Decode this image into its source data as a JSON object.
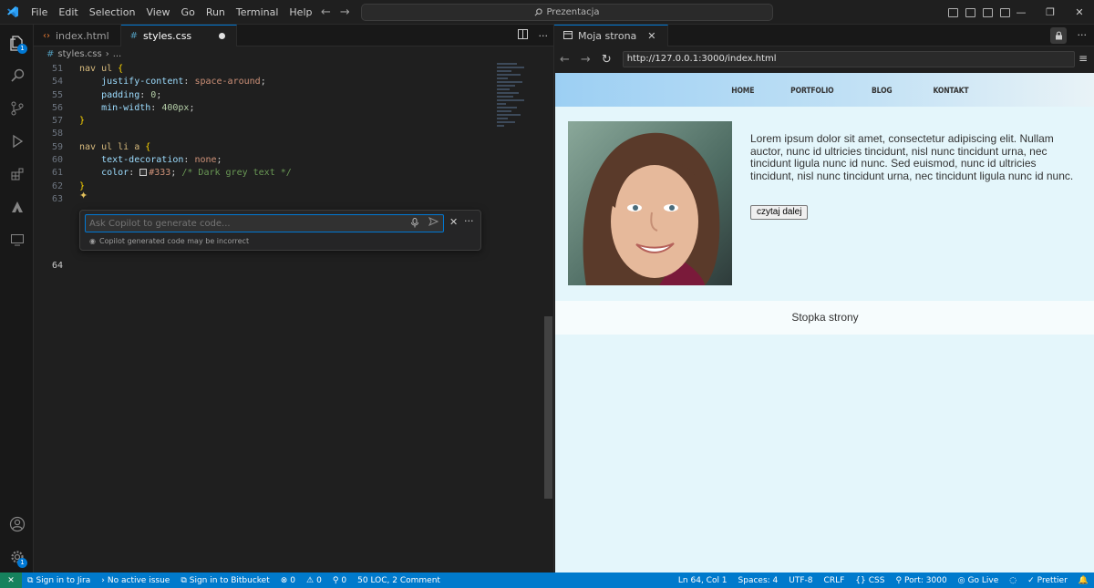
{
  "titlebar": {
    "menu": [
      "File",
      "Edit",
      "Selection",
      "View",
      "Go",
      "Run",
      "Terminal",
      "Help"
    ],
    "search_text": "Prezentacja"
  },
  "activity_bar": {
    "explorer_badge": "1",
    "settings_badge": "1"
  },
  "editor": {
    "tabs": [
      {
        "label": "index.html",
        "icon": "html-icon"
      },
      {
        "label": "styles.css",
        "icon": "css-icon",
        "modified": true
      }
    ],
    "breadcrumb": {
      "file": "styles.css",
      "rest": "..."
    },
    "lines": [
      {
        "n": "51",
        "parts": [
          [
            "sel",
            "nav ul "
          ],
          [
            "br",
            "{"
          ]
        ]
      },
      {
        "n": "54",
        "parts": [
          [
            "prop",
            "    justify-content"
          ],
          [
            "",
            "; "
          ],
          [
            "val",
            "space-around"
          ],
          [
            "",
            ";"
          ]
        ]
      },
      {
        "n": "55",
        "parts": [
          [
            "prop",
            "    padding"
          ],
          [
            "",
            ": "
          ],
          [
            "num",
            "0"
          ],
          [
            "",
            ";"
          ]
        ]
      },
      {
        "n": "56",
        "parts": [
          [
            "prop",
            "    min-width"
          ],
          [
            "",
            ": "
          ],
          [
            "num",
            "400px"
          ],
          [
            "",
            ";"
          ]
        ]
      },
      {
        "n": "57",
        "parts": [
          [
            "br",
            "}"
          ]
        ]
      },
      {
        "n": "58",
        "parts": []
      },
      {
        "n": "59",
        "parts": [
          [
            "sel",
            "nav ul li a "
          ],
          [
            "br",
            "{"
          ]
        ]
      },
      {
        "n": "60",
        "parts": [
          [
            "prop",
            "    text-decoration"
          ],
          [
            "",
            ": "
          ],
          [
            "val",
            "none"
          ],
          [
            "",
            ";"
          ]
        ]
      },
      {
        "n": "61",
        "parts": [
          [
            "prop",
            "    color"
          ],
          [
            "",
            ": "
          ],
          [
            "swatch",
            ""
          ],
          [
            "val",
            "#333"
          ],
          [
            "",
            "; "
          ],
          [
            "com",
            "/* Dark grey text */"
          ]
        ]
      },
      {
        "n": "62",
        "parts": [
          [
            "br",
            "}"
          ]
        ]
      },
      {
        "n": "63",
        "parts": []
      }
    ],
    "last_line_number": "64",
    "copilot": {
      "placeholder": "Ask Copilot to generate code...",
      "note": "Copilot generated code may be incorrect"
    }
  },
  "browser": {
    "tab_title": "Moja strona",
    "url": "http://127.0.0.1:3000/index.html",
    "nav": [
      "HOME",
      "PORTFOLIO",
      "BLOG",
      "KONTAKT"
    ],
    "article_text": "Lorem ipsum dolor sit amet, consectetur adipiscing elit. Nullam auctor, nunc id ultricies tincidunt, nisl nunc tincidunt urna, nec tincidunt ligula nunc id nunc. Sed euismod, nunc id ultricies tincidunt, nisl nunc tincidunt urna, nec tincidunt ligula nunc id nunc.",
    "read_more": "czytaj dalej",
    "footer": "Stopka strony"
  },
  "statusbar": {
    "left": [
      {
        "icon": "jira-icon",
        "label": "Sign in to Jira"
      },
      {
        "icon": "issue-icon",
        "label": "No active issue"
      },
      {
        "icon": "bitbucket-icon",
        "label": "Sign in to Bitbucket"
      },
      {
        "icon": "error-icon",
        "label": "0"
      },
      {
        "icon": "warning-icon",
        "label": "0"
      },
      {
        "icon": "ports-icon",
        "label": "0"
      },
      {
        "icon": "",
        "label": "50 LOC, 2 Comment"
      }
    ],
    "right": [
      {
        "icon": "",
        "label": "Ln 64, Col 1"
      },
      {
        "icon": "",
        "label": "Spaces: 4"
      },
      {
        "icon": "",
        "label": "UTF-8"
      },
      {
        "icon": "",
        "label": "CRLF"
      },
      {
        "icon": "braces-icon",
        "label": "CSS"
      },
      {
        "icon": "port-icon",
        "label": "Port: 3000"
      },
      {
        "icon": "golive-icon",
        "label": "Go Live"
      },
      {
        "icon": "spinner-icon",
        "label": ""
      },
      {
        "icon": "check-icon",
        "label": "Prettier"
      },
      {
        "icon": "bell-icon",
        "label": ""
      }
    ]
  },
  "colors": {
    "statusbar": "#007acc",
    "accent": "#0078d4",
    "page_bg": "#e4f6fb"
  }
}
